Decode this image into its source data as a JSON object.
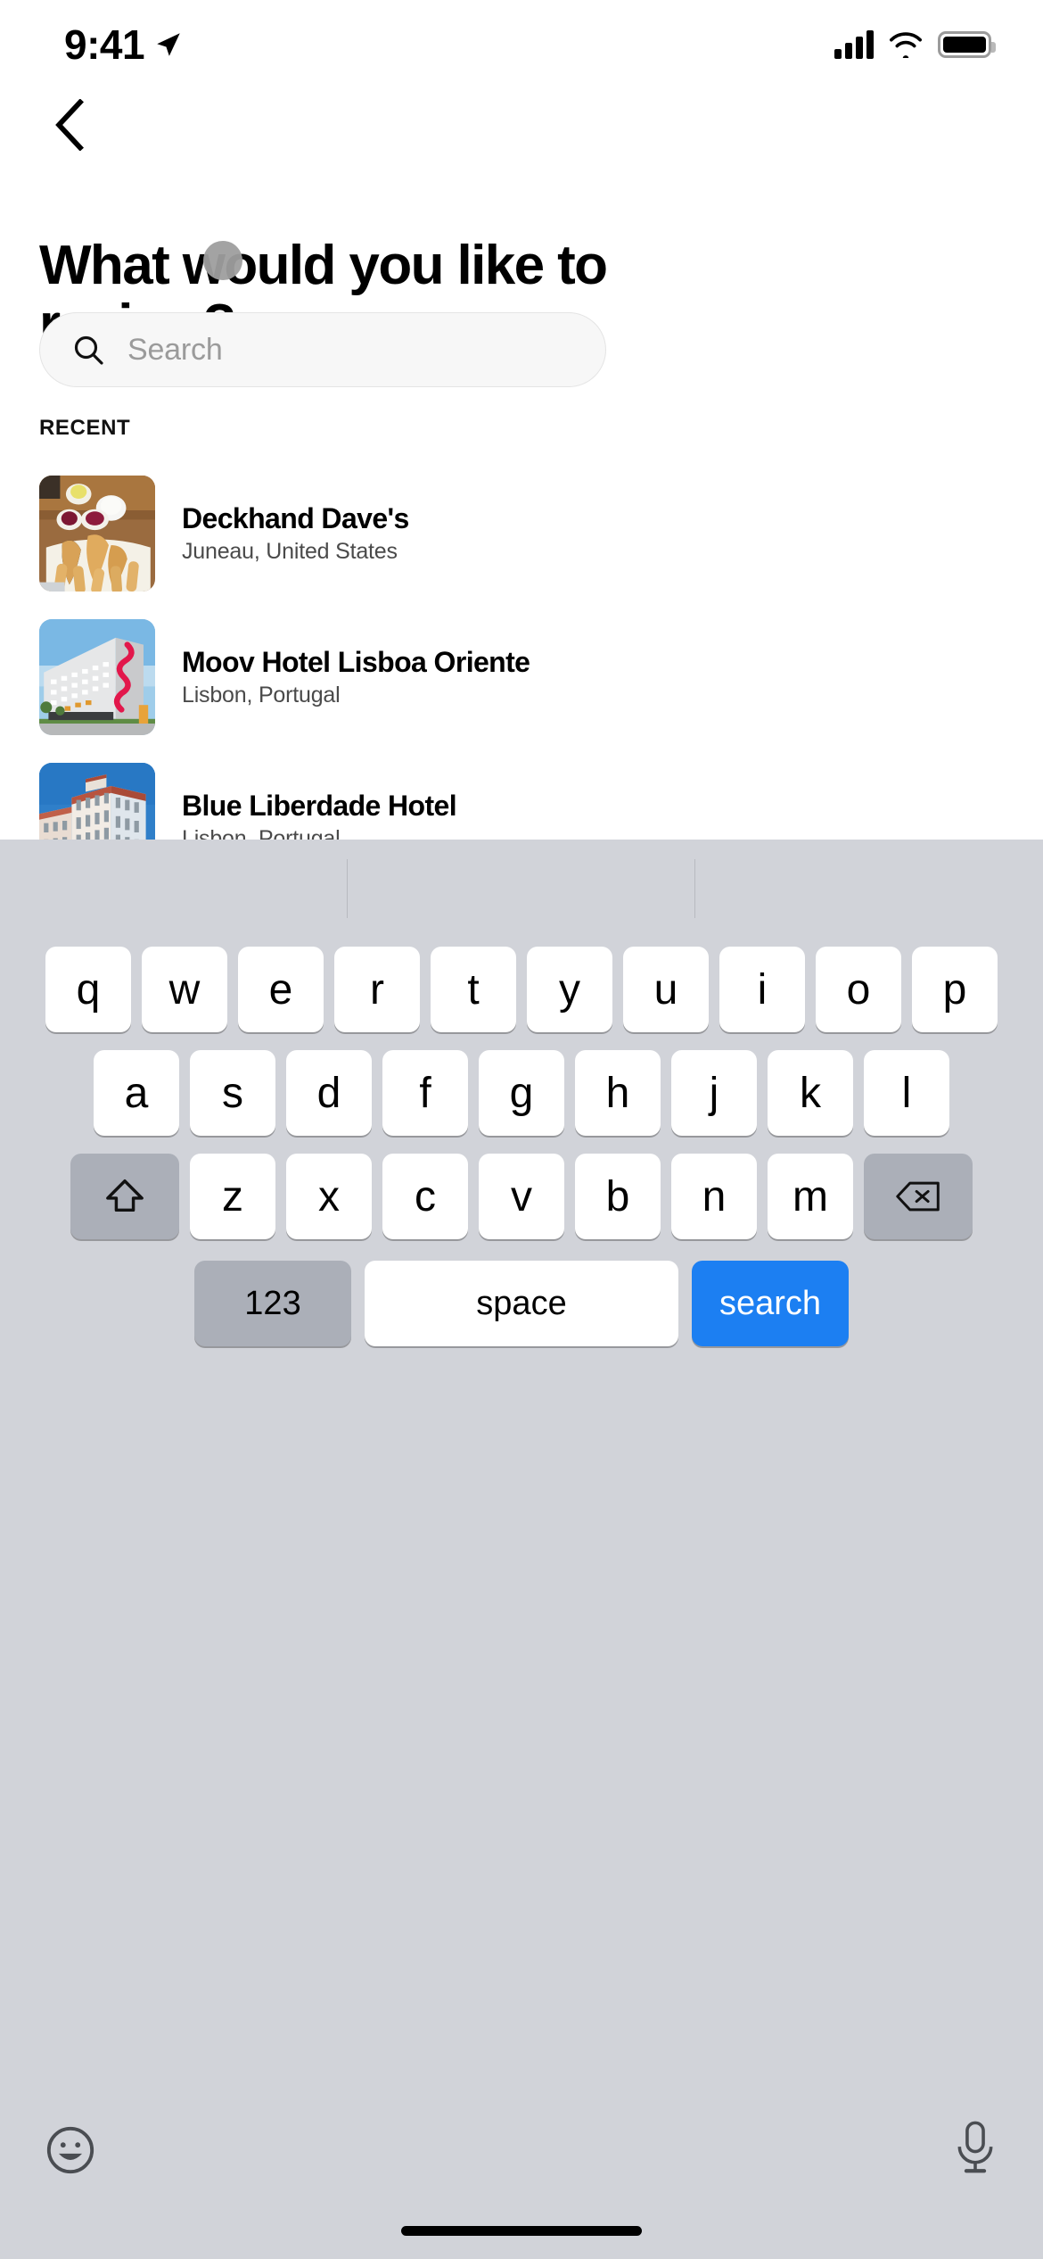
{
  "status_bar": {
    "time": "9:41",
    "location_icon": "location-arrow-icon",
    "signal_icon": "cellular-bars-icon",
    "wifi_icon": "wifi-icon",
    "battery_icon": "battery-full-icon"
  },
  "header": {
    "back_icon": "chevron-left-icon",
    "title": "What would you like to review?"
  },
  "search": {
    "icon": "search-icon",
    "placeholder": "Search",
    "value": ""
  },
  "recent": {
    "section_label": "RECENT",
    "items": [
      {
        "title": "Deckhand Dave's",
        "subtitle": "Juneau, United States",
        "thumbnail": "fried-fish-and-chips-photo"
      },
      {
        "title": "Moov Hotel Lisboa Oriente",
        "subtitle": "Lisbon, Portugal",
        "thumbnail": "modern-white-hotel-building-photo"
      },
      {
        "title": "Blue Liberdade Hotel",
        "subtitle": "Lisbon, Portugal",
        "thumbnail": "classic-lisbon-building-photo"
      }
    ]
  },
  "keyboard": {
    "row1": [
      "q",
      "w",
      "e",
      "r",
      "t",
      "y",
      "u",
      "i",
      "o",
      "p"
    ],
    "row2": [
      "a",
      "s",
      "d",
      "f",
      "g",
      "h",
      "j",
      "k",
      "l"
    ],
    "row3": [
      "z",
      "x",
      "c",
      "v",
      "b",
      "n",
      "m"
    ],
    "shift_icon": "shift-arrow-icon",
    "backspace_icon": "backspace-delete-icon",
    "numbers_label": "123",
    "space_label": "space",
    "return_label": "search",
    "emoji_icon": "emoji-smiley-icon",
    "mic_icon": "microphone-icon",
    "return_key_color": "#1c7ff2"
  }
}
